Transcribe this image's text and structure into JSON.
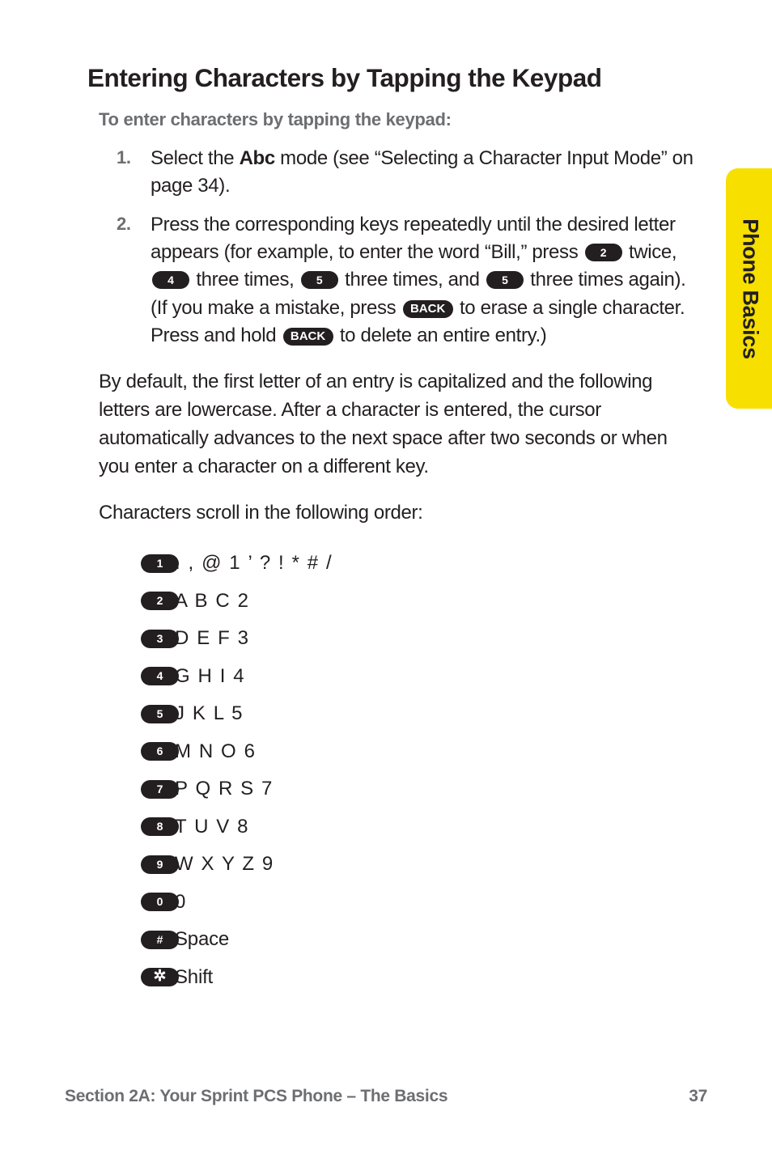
{
  "page_title": "Entering Characters by Tapping the Keypad",
  "subhead": "To enter characters by tapping the keypad:",
  "side_tab": {
    "label": "Phone Basics",
    "color": "#f7df00"
  },
  "steps": [
    {
      "num": "1.",
      "before_bold": "Select the ",
      "bold": "Abc",
      "after_bold": " mode (see “Selecting a Character Input Mode” on page 34)."
    },
    {
      "num": "2.",
      "seg1": "Press the corresponding keys repeatedly until the desired letter appears (for example, to enter the word “Bill,” press ",
      "key1": "2",
      "seg2": " twice, ",
      "key2": "4",
      "seg3": " three times, ",
      "key3": "5",
      "seg4": " three times, and ",
      "key4": "5",
      "seg5": " three times again). (If you make a mistake, press ",
      "key5": "BACK",
      "seg6": " to erase a single character. Press and hold ",
      "key6": "BACK",
      "seg7": " to delete an entire entry.)"
    }
  ],
  "paragraphs": [
    "By default, the first letter of an entry is capitalized and the following letters are lowercase. After a character is entered, the cursor automatically advances to the next space after two seconds or when you enter a character on a different key.",
    "Characters scroll in the following order:"
  ],
  "scroll_list": [
    {
      "key": "1",
      "chars": ". , @ 1 ’ ? ! * # /"
    },
    {
      "key": "2",
      "chars": "A B C 2"
    },
    {
      "key": "3",
      "chars": "D E F 3"
    },
    {
      "key": "4",
      "chars": "G H I 4"
    },
    {
      "key": "5",
      "chars": "J K L 5"
    },
    {
      "key": "6",
      "chars": "M N O 6"
    },
    {
      "key": "7",
      "chars": "P Q R S 7"
    },
    {
      "key": "8",
      "chars": "T U V 8"
    },
    {
      "key": "9",
      "chars": "W X Y Z 9"
    },
    {
      "key": "0",
      "chars": "0"
    },
    {
      "key": "#",
      "chars": "Space"
    },
    {
      "key": "✲",
      "chars": "Shift"
    }
  ],
  "footer": {
    "section": "Section 2A: Your Sprint PCS Phone – The Basics",
    "page_number": "37"
  }
}
